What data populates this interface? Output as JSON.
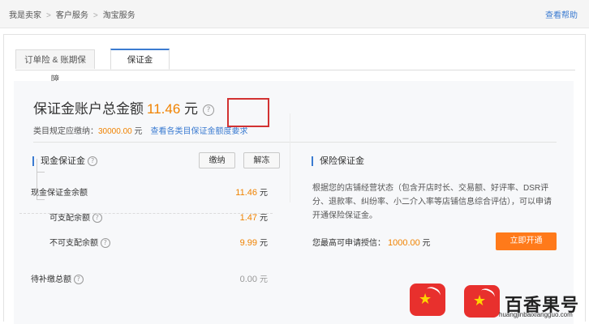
{
  "breadcrumb": [
    "我是卖家",
    "客户服务",
    "淘宝服务"
  ],
  "help_link": "查看帮助",
  "tabs": [
    {
      "label": "订单险 & 账期保障",
      "active": false
    },
    {
      "label": "保证金",
      "active": true
    }
  ],
  "summary": {
    "title": "保证金账户总金额",
    "amount": "11.46",
    "unit": "元",
    "rule_label": "类目规定应缴纳：",
    "rule_amount": "30000.00",
    "rule_unit": "元",
    "rule_link": "查看各类目保证金额度要求"
  },
  "cash": {
    "title": "现金保证金",
    "pay_button": "缴纳",
    "unfreeze_button": "解冻",
    "rows": [
      {
        "label": "现金保证金余额",
        "value": "11.46",
        "unit": "元"
      },
      {
        "label": "可支配余额",
        "value": "1.47",
        "unit": "元"
      },
      {
        "label": "不可支配余额",
        "value": "9.99",
        "unit": "元"
      },
      {
        "label": "待补缴总额",
        "value": "0.00",
        "unit": "元"
      }
    ]
  },
  "insurance": {
    "title": "保险保证金",
    "description": "根据您的店铺经营状态（包含开店时长、交易额、好评率、DSR评分、退款率、纠纷率、小二介入率等店铺信息综合评估），可以申请开通保险保证金。",
    "credit_label": "您最高可申请授信：",
    "credit_value": "1000.00",
    "credit_unit": "元",
    "open_button": "立即开通"
  },
  "watermark": {
    "name": "百香果号",
    "url": "huangjinbaixiangguo.com"
  },
  "colors": {
    "accent_blue": "#3b7bd1",
    "amount_orange": "#f08200",
    "button_orange": "#ff7a1a",
    "highlight_red": "#d23232"
  }
}
